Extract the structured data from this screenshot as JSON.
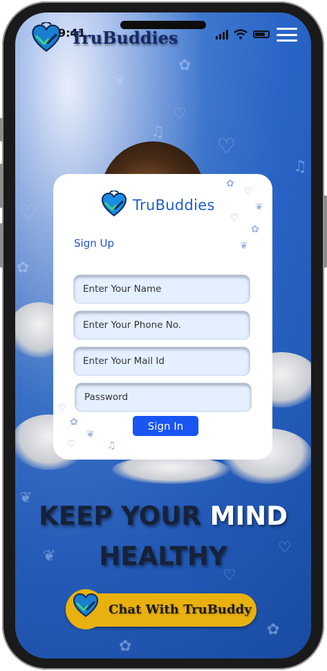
{
  "status_bar": {
    "time": "9:41"
  },
  "header": {
    "brand": "TruBuddies",
    "logo_icon": "heart-hands-icon",
    "menu_icon": "hamburger-menu-icon"
  },
  "card": {
    "brand": "TruBuddies",
    "form_title": "Sign Up",
    "fields": {
      "name_placeholder": "Enter Your Name",
      "phone_placeholder": "Enter Your Phone No.",
      "mail_placeholder": "Enter Your Mail Id",
      "password_placeholder": "Password"
    },
    "submit_label": "Sign In"
  },
  "headline": {
    "part1": "KEEP YOUR",
    "part2": "MIND",
    "line2": "HEALTHY"
  },
  "chat_button": {
    "label": "Chat With TruBuddy"
  },
  "colors": {
    "accent_blue": "#1955f0",
    "brand_blue": "#1b5ec9",
    "button_yellow": "#e9b10f"
  }
}
